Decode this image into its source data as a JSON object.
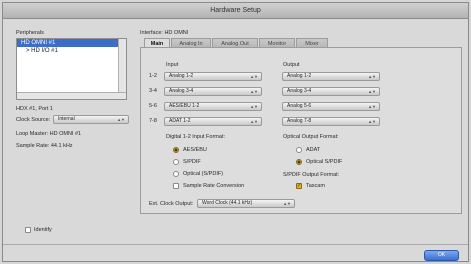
{
  "window": {
    "title": "Hardware Setup"
  },
  "peripherals": {
    "label": "Peripherals",
    "items": [
      "HD OMNI #1",
      "> HD I/O #1"
    ]
  },
  "device": {
    "port_info": "HDX #1, Port 1",
    "clock_source_label": "Clock Source:",
    "clock_source_value": "Internal",
    "loop_master": "Loop Master: HD OMNI #1",
    "sample_rate": "Sample Rate: 44.1 kHz"
  },
  "identify": {
    "label": "Identify",
    "checked": false
  },
  "interface": {
    "label": "Interface: HD OMNI"
  },
  "tabs": [
    {
      "label": "Main",
      "active": true
    },
    {
      "label": "Analog In",
      "active": false
    },
    {
      "label": "Analog Out",
      "active": false
    },
    {
      "label": "Monitor",
      "active": false
    },
    {
      "label": "Mixer",
      "active": false
    }
  ],
  "main": {
    "input_header": "Input",
    "output_header": "Output",
    "rows": [
      {
        "channel": "1-2",
        "input": "Analog 1-2",
        "output": "Analog 1-2"
      },
      {
        "channel": "3-4",
        "input": "Analog 3-4",
        "output": "Analog 3-4"
      },
      {
        "channel": "5-6",
        "input": "AES/EBU 1-2",
        "output": "Analog 5-6"
      },
      {
        "channel": "7-8",
        "input": "ADAT 1-2",
        "output": "Analog 7-8"
      }
    ],
    "digital_input_format": {
      "label": "Digital 1-2 Input Format:",
      "options": [
        {
          "label": "AES/EBU",
          "selected": true
        },
        {
          "label": "S/PDIF",
          "selected": false
        },
        {
          "label": "Optical (S/PDIF)",
          "selected": false
        }
      ],
      "src_label": "Sample Rate Conversion",
      "src_checked": false
    },
    "optical_output_format": {
      "label": "Optical Output Format:",
      "options": [
        {
          "label": "ADAT",
          "selected": false
        },
        {
          "label": "Optical S/PDIF",
          "selected": true
        }
      ]
    },
    "spdif_output_format": {
      "label": "S/PDIF Output Format:",
      "tascam_label": "Tascam",
      "tascam_checked": true
    },
    "ext_clock_output": {
      "label": "Ext. Clock Output:",
      "value": "Word Clock (44.1 kHz)"
    }
  },
  "buttons": {
    "ok": "OK"
  }
}
